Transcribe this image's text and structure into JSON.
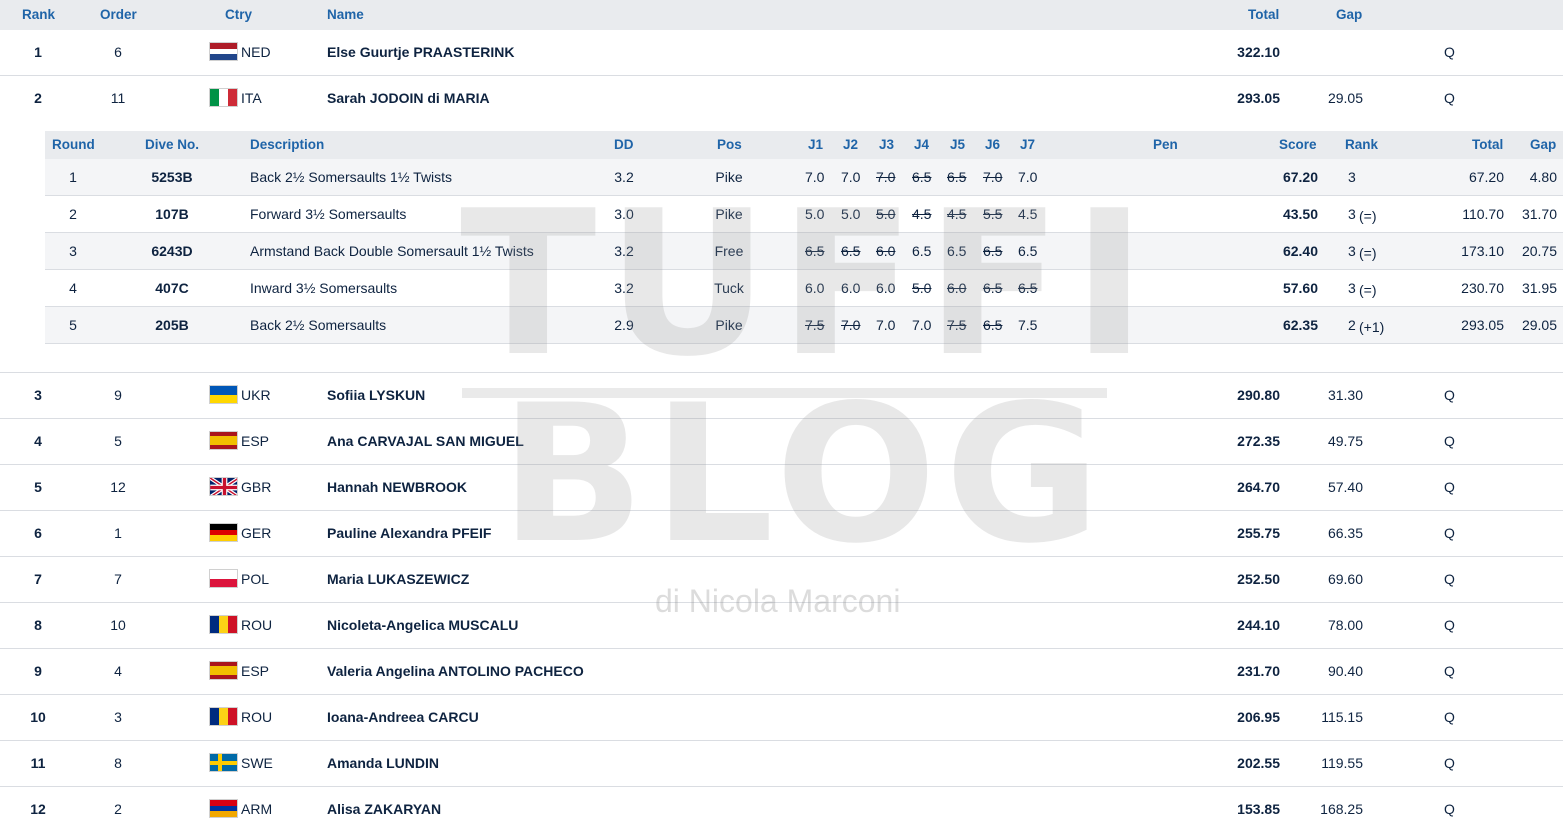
{
  "header": {
    "rank": "Rank",
    "order": "Order",
    "ctry": "Ctry",
    "name": "Name",
    "total": "Total",
    "gap": "Gap"
  },
  "athletes": [
    {
      "rank": "1",
      "order": "6",
      "ctry": "NED",
      "name": "Else Guurtje PRAASTERINK",
      "total": "322.10",
      "gap": "",
      "q": "Q"
    },
    {
      "rank": "2",
      "order": "11",
      "ctry": "ITA",
      "name": "Sarah JODOIN di MARIA",
      "total": "293.05",
      "gap": "29.05",
      "q": "Q"
    },
    {
      "rank": "3",
      "order": "9",
      "ctry": "UKR",
      "name": "Sofiia LYSKUN",
      "total": "290.80",
      "gap": "31.30",
      "q": "Q"
    },
    {
      "rank": "4",
      "order": "5",
      "ctry": "ESP",
      "name": "Ana CARVAJAL SAN MIGUEL",
      "total": "272.35",
      "gap": "49.75",
      "q": "Q"
    },
    {
      "rank": "5",
      "order": "12",
      "ctry": "GBR",
      "name": "Hannah NEWBROOK",
      "total": "264.70",
      "gap": "57.40",
      "q": "Q"
    },
    {
      "rank": "6",
      "order": "1",
      "ctry": "GER",
      "name": "Pauline Alexandra PFEIF",
      "total": "255.75",
      "gap": "66.35",
      "q": "Q"
    },
    {
      "rank": "7",
      "order": "7",
      "ctry": "POL",
      "name": "Maria LUKASZEWICZ",
      "total": "252.50",
      "gap": "69.60",
      "q": "Q"
    },
    {
      "rank": "8",
      "order": "10",
      "ctry": "ROU",
      "name": "Nicoleta-Angelica MUSCALU",
      "total": "244.10",
      "gap": "78.00",
      "q": "Q"
    },
    {
      "rank": "9",
      "order": "4",
      "ctry": "ESP",
      "name": "Valeria Angelina ANTOLINO PACHECO",
      "total": "231.70",
      "gap": "90.40",
      "q": "Q"
    },
    {
      "rank": "10",
      "order": "3",
      "ctry": "ROU",
      "name": "Ioana-Andreea CARCU",
      "total": "206.95",
      "gap": "115.15",
      "q": "Q"
    },
    {
      "rank": "11",
      "order": "8",
      "ctry": "SWE",
      "name": "Amanda LUNDIN",
      "total": "202.55",
      "gap": "119.55",
      "q": "Q"
    },
    {
      "rank": "12",
      "order": "2",
      "ctry": "ARM",
      "name": "Alisa ZAKARYAN",
      "total": "153.85",
      "gap": "168.25",
      "q": "Q"
    }
  ],
  "flag_colors": {
    "NED": [
      "#ae1c28",
      "#ffffff",
      "#21468b"
    ],
    "ITA": [
      "#009246",
      "#ffffff",
      "#ce2b37"
    ],
    "UKR": [
      "#0057b7",
      "#ffd700"
    ],
    "ESP": [
      "#aa151b",
      "#f1bf00",
      "#aa151b"
    ],
    "GER": [
      "#000000",
      "#dd0000",
      "#ffce00"
    ],
    "POL": [
      "#ffffff",
      "#dc143c"
    ],
    "ROU": [
      "#002b7f",
      "#fcd116",
      "#ce1126"
    ],
    "SWE": [
      "#006aa7",
      "#fecc00"
    ],
    "ARM": [
      "#d90012",
      "#0033a0",
      "#f2a800"
    ],
    "GBR": [
      "#012169",
      "#ffffff",
      "#c8102e"
    ]
  },
  "detail_header": {
    "round": "Round",
    "dive": "Dive No.",
    "desc": "Description",
    "dd": "DD",
    "pos": "Pos",
    "j1": "J1",
    "j2": "J2",
    "j3": "J3",
    "j4": "J4",
    "j5": "J5",
    "j6": "J6",
    "j7": "J7",
    "pen": "Pen",
    "score": "Score",
    "rank": "Rank",
    "total": "Total",
    "gap": "Gap"
  },
  "dives": [
    {
      "round": "1",
      "dive": "5253B",
      "desc": "Back 2½ Somersaults 1½ Twists",
      "dd": "3.2",
      "pos": "Pike",
      "j": [
        [
          "7.0",
          false
        ],
        [
          "7.0",
          false
        ],
        [
          "7.0",
          true
        ],
        [
          "6.5",
          true
        ],
        [
          "6.5",
          true
        ],
        [
          "7.0",
          true
        ],
        [
          "7.0",
          false
        ]
      ],
      "score": "67.20",
      "rank": "3",
      "rank_note": "",
      "total": "67.20",
      "gap": "4.80"
    },
    {
      "round": "2",
      "dive": "107B",
      "desc": "Forward 3½ Somersaults",
      "dd": "3.0",
      "pos": "Pike",
      "j": [
        [
          "5.0",
          false
        ],
        [
          "5.0",
          false
        ],
        [
          "5.0",
          true
        ],
        [
          "4.5",
          true
        ],
        [
          "4.5",
          true
        ],
        [
          "5.5",
          true
        ],
        [
          "4.5",
          false
        ]
      ],
      "score": "43.50",
      "rank": "3",
      "rank_note": "(=)",
      "total": "110.70",
      "gap": "31.70"
    },
    {
      "round": "3",
      "dive": "6243D",
      "desc": "Armstand Back Double Somersault 1½ Twists",
      "dd": "3.2",
      "pos": "Free",
      "j": [
        [
          "6.5",
          true
        ],
        [
          "6.5",
          true
        ],
        [
          "6.0",
          true
        ],
        [
          "6.5",
          false
        ],
        [
          "6.5",
          false
        ],
        [
          "6.5",
          true
        ],
        [
          "6.5",
          false
        ]
      ],
      "score": "62.40",
      "rank": "3",
      "rank_note": "(=)",
      "total": "173.10",
      "gap": "20.75"
    },
    {
      "round": "4",
      "dive": "407C",
      "desc": "Inward 3½ Somersaults",
      "dd": "3.2",
      "pos": "Tuck",
      "j": [
        [
          "6.0",
          false
        ],
        [
          "6.0",
          false
        ],
        [
          "6.0",
          false
        ],
        [
          "5.0",
          true
        ],
        [
          "6.0",
          true
        ],
        [
          "6.5",
          true
        ],
        [
          "6.5",
          true
        ]
      ],
      "score": "57.60",
      "rank": "3",
      "rank_note": "(=)",
      "total": "230.70",
      "gap": "31.95"
    },
    {
      "round": "5",
      "dive": "205B",
      "desc": "Back 2½ Somersaults",
      "dd": "2.9",
      "pos": "Pike",
      "j": [
        [
          "7.5",
          true
        ],
        [
          "7.0",
          true
        ],
        [
          "7.0",
          false
        ],
        [
          "7.0",
          false
        ],
        [
          "7.5",
          true
        ],
        [
          "6.5",
          true
        ],
        [
          "7.5",
          false
        ]
      ],
      "score": "62.35",
      "rank": "2",
      "rank_note": "(+1)",
      "total": "293.05",
      "gap": "29.05"
    }
  ],
  "watermark": {
    "line1": "TUFFI",
    "line2": "BLOG",
    "line3": "di Nicola Marconi"
  }
}
